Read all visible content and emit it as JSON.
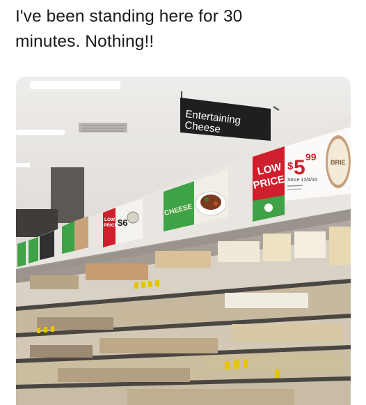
{
  "post": {
    "caption_line1": "I've been standing here for 30",
    "caption_line2": "minutes. Nothing!!"
  },
  "photo": {
    "aisle_sign": {
      "line1": "Entertaining",
      "line2": "Cheese"
    },
    "price_tag": {
      "low_price_line1": "LOW",
      "low_price_line2": "PRICE",
      "price_dollar": "$",
      "price_main": "5",
      "price_cents": "99",
      "since": "Since 12/4/16",
      "cheese_label": "BRIE"
    },
    "small_tag": {
      "line1": "LOW",
      "line2": "PRICE",
      "price": "$6"
    },
    "banner_label": "CHEESE",
    "colors": {
      "price_red": "#cf1e2c",
      "brand_green": "#3fa247",
      "sign_black": "#1f1f1f"
    }
  }
}
